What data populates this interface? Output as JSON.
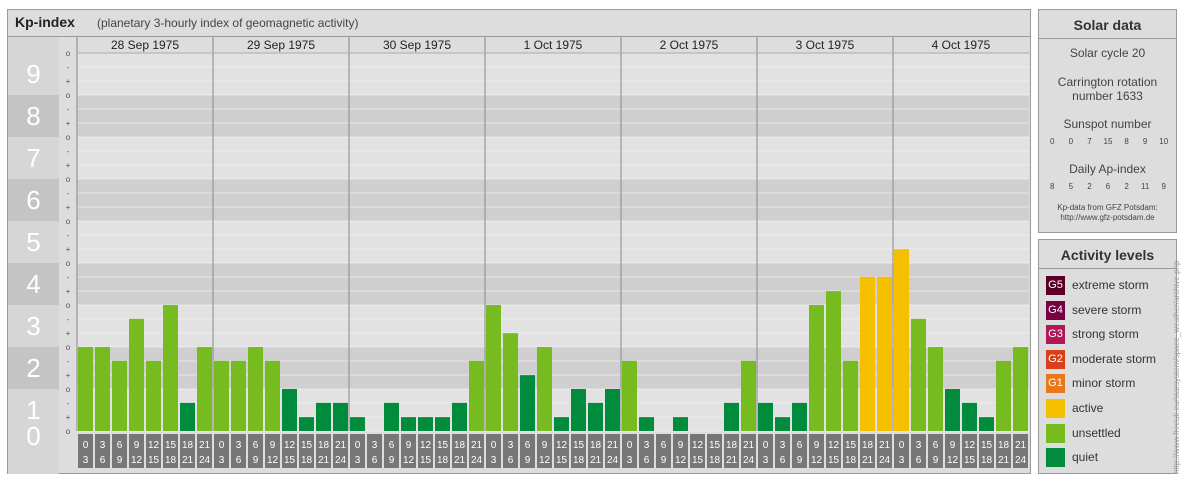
{
  "header": {
    "title": "Kp-index",
    "subtitle": "(planetary 3-hourly index of geomagnetic activity)"
  },
  "chart_data": {
    "type": "bar",
    "ylim": [
      0,
      9
    ],
    "y_ticks": [
      "0",
      "1",
      "2",
      "3",
      "4",
      "5",
      "6",
      "7",
      "8",
      "9"
    ],
    "sub_ticks": [
      "o",
      "+",
      "-"
    ],
    "days": [
      "28 Sep 1975",
      "29 Sep 1975",
      "30 Sep 1975",
      "1 Oct 1975",
      "2 Oct 1975",
      "3 Oct 1975",
      "4 Oct 1975"
    ],
    "interval_top": [
      "0",
      "3",
      "6",
      "9",
      "12",
      "15",
      "18",
      "21"
    ],
    "interval_bottom": [
      "3",
      "6",
      "9",
      "12",
      "15",
      "18",
      "21",
      "24"
    ],
    "values": [
      2.0,
      2.0,
      1.67,
      2.67,
      1.67,
      3.0,
      0.67,
      2.0,
      1.67,
      1.67,
      2.0,
      1.67,
      1.0,
      0.33,
      0.67,
      0.67,
      0.33,
      0.0,
      0.67,
      0.33,
      0.33,
      0.33,
      0.67,
      1.67,
      3.0,
      2.33,
      1.33,
      2.0,
      0.33,
      1.0,
      0.67,
      1.0,
      1.67,
      0.33,
      0.0,
      0.33,
      0.0,
      0.0,
      0.67,
      1.67,
      0.67,
      0.33,
      0.67,
      3.0,
      3.33,
      1.67,
      3.67,
      3.67,
      4.33,
      2.67,
      2.0,
      1.0,
      0.67,
      0.33,
      1.67,
      2.0
    ],
    "colors": {
      "quiet": "#008c3c",
      "unsettled": "#76bc21",
      "active": "#f5c000"
    }
  },
  "solar": {
    "title": "Solar data",
    "cycle": "Solar cycle 20",
    "carrington_line1": "Carrington rotation",
    "carrington_line2": "number 1633",
    "sunspot_title": "Sunspot number",
    "sunspot_values": [
      "0",
      "0",
      "7",
      "15",
      "8",
      "9",
      "10"
    ],
    "ap_title": "Daily Ap-index",
    "ap_values": [
      "8",
      "5",
      "2",
      "6",
      "2",
      "11",
      "9"
    ],
    "credit_line1": "Kp-data from GFZ Potsdam:",
    "credit_line2": "http://www.gfz-potsdam.de"
  },
  "activity": {
    "title": "Activity levels",
    "items": [
      {
        "badge": "G5",
        "label": "extreme storm",
        "color": "#5a0028"
      },
      {
        "badge": "G4",
        "label": "severe storm",
        "color": "#7a0044"
      },
      {
        "badge": "G3",
        "label": "strong storm",
        "color": "#b0185a"
      },
      {
        "badge": "G2",
        "label": "moderate storm",
        "color": "#d8401c"
      },
      {
        "badge": "G1",
        "label": "minor storm",
        "color": "#e8781c"
      },
      {
        "badge": "",
        "label": "active",
        "color": "#f5c000"
      },
      {
        "badge": "",
        "label": "unsettled",
        "color": "#76bc21"
      },
      {
        "badge": "",
        "label": "quiet",
        "color": "#008c3c"
      }
    ]
  },
  "watermark": "http://www.freeuk.eu/starsystem/space_weather/archive.php"
}
